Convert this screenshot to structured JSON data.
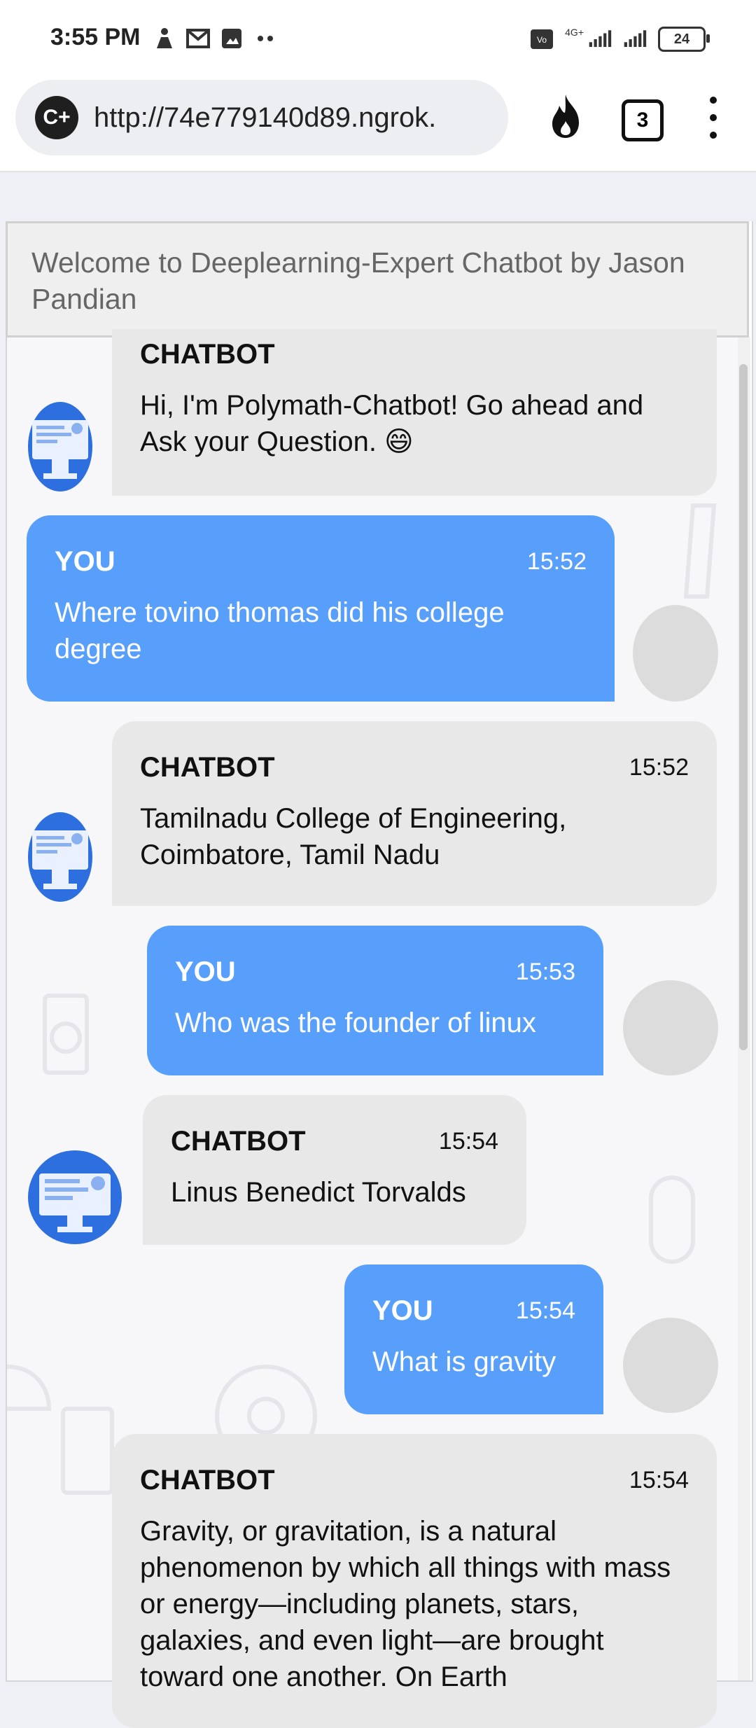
{
  "status_bar": {
    "time": "3:55 PM",
    "network": "4G+",
    "battery": "24"
  },
  "browser": {
    "url": "http://74e779140d89.ngrok.",
    "site_badge": "C+",
    "tab_count": "3"
  },
  "chat": {
    "header": "Welcome to Deeplearning-Expert Chatbot by Jason Pandian",
    "messages": [
      {
        "sender": "CHATBOT",
        "time": "",
        "text": "Hi, I'm Polymath-Chatbot! Go ahead and Ask your Question. 😄"
      },
      {
        "sender": "YOU",
        "time": "15:52",
        "text": "Where tovino thomas did his college degree"
      },
      {
        "sender": "CHATBOT",
        "time": "15:52",
        "text": "Tamilnadu College of Engineering, Coimbatore, Tamil Nadu"
      },
      {
        "sender": "YOU",
        "time": "15:53",
        "text": "Who was the founder of linux"
      },
      {
        "sender": "CHATBOT",
        "time": "15:54",
        "text": "Linus Benedict Torvalds"
      },
      {
        "sender": "YOU",
        "time": "15:54",
        "text": "What is gravity"
      },
      {
        "sender": "CHATBOT",
        "time": "15:54",
        "text": "Gravity, or gravitation, is a natural phenomenon by which all things with mass or energy—including planets, stars, galaxies, and even light—are brought toward one another. On Earth"
      }
    ]
  }
}
